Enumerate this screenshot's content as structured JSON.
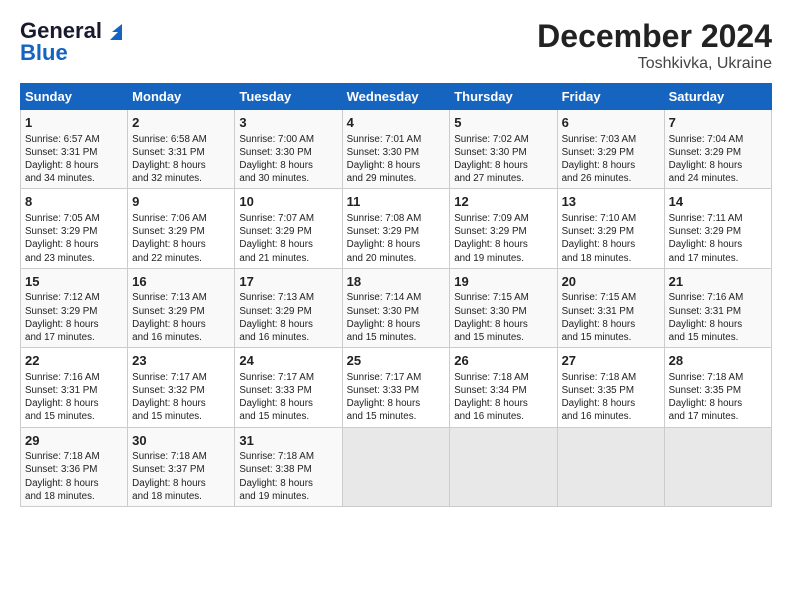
{
  "logo": {
    "line1": "General",
    "line2": "Blue"
  },
  "title": "December 2024",
  "subtitle": "Toshkivka, Ukraine",
  "headers": [
    "Sunday",
    "Monday",
    "Tuesday",
    "Wednesday",
    "Thursday",
    "Friday",
    "Saturday"
  ],
  "weeks": [
    [
      {
        "day": "1",
        "info": "Sunrise: 6:57 AM\nSunset: 3:31 PM\nDaylight: 8 hours\nand 34 minutes."
      },
      {
        "day": "2",
        "info": "Sunrise: 6:58 AM\nSunset: 3:31 PM\nDaylight: 8 hours\nand 32 minutes."
      },
      {
        "day": "3",
        "info": "Sunrise: 7:00 AM\nSunset: 3:30 PM\nDaylight: 8 hours\nand 30 minutes."
      },
      {
        "day": "4",
        "info": "Sunrise: 7:01 AM\nSunset: 3:30 PM\nDaylight: 8 hours\nand 29 minutes."
      },
      {
        "day": "5",
        "info": "Sunrise: 7:02 AM\nSunset: 3:30 PM\nDaylight: 8 hours\nand 27 minutes."
      },
      {
        "day": "6",
        "info": "Sunrise: 7:03 AM\nSunset: 3:29 PM\nDaylight: 8 hours\nand 26 minutes."
      },
      {
        "day": "7",
        "info": "Sunrise: 7:04 AM\nSunset: 3:29 PM\nDaylight: 8 hours\nand 24 minutes."
      }
    ],
    [
      {
        "day": "8",
        "info": "Sunrise: 7:05 AM\nSunset: 3:29 PM\nDaylight: 8 hours\nand 23 minutes."
      },
      {
        "day": "9",
        "info": "Sunrise: 7:06 AM\nSunset: 3:29 PM\nDaylight: 8 hours\nand 22 minutes."
      },
      {
        "day": "10",
        "info": "Sunrise: 7:07 AM\nSunset: 3:29 PM\nDaylight: 8 hours\nand 21 minutes."
      },
      {
        "day": "11",
        "info": "Sunrise: 7:08 AM\nSunset: 3:29 PM\nDaylight: 8 hours\nand 20 minutes."
      },
      {
        "day": "12",
        "info": "Sunrise: 7:09 AM\nSunset: 3:29 PM\nDaylight: 8 hours\nand 19 minutes."
      },
      {
        "day": "13",
        "info": "Sunrise: 7:10 AM\nSunset: 3:29 PM\nDaylight: 8 hours\nand 18 minutes."
      },
      {
        "day": "14",
        "info": "Sunrise: 7:11 AM\nSunset: 3:29 PM\nDaylight: 8 hours\nand 17 minutes."
      }
    ],
    [
      {
        "day": "15",
        "info": "Sunrise: 7:12 AM\nSunset: 3:29 PM\nDaylight: 8 hours\nand 17 minutes."
      },
      {
        "day": "16",
        "info": "Sunrise: 7:13 AM\nSunset: 3:29 PM\nDaylight: 8 hours\nand 16 minutes."
      },
      {
        "day": "17",
        "info": "Sunrise: 7:13 AM\nSunset: 3:29 PM\nDaylight: 8 hours\nand 16 minutes."
      },
      {
        "day": "18",
        "info": "Sunrise: 7:14 AM\nSunset: 3:30 PM\nDaylight: 8 hours\nand 15 minutes."
      },
      {
        "day": "19",
        "info": "Sunrise: 7:15 AM\nSunset: 3:30 PM\nDaylight: 8 hours\nand 15 minutes."
      },
      {
        "day": "20",
        "info": "Sunrise: 7:15 AM\nSunset: 3:31 PM\nDaylight: 8 hours\nand 15 minutes."
      },
      {
        "day": "21",
        "info": "Sunrise: 7:16 AM\nSunset: 3:31 PM\nDaylight: 8 hours\nand 15 minutes."
      }
    ],
    [
      {
        "day": "22",
        "info": "Sunrise: 7:16 AM\nSunset: 3:31 PM\nDaylight: 8 hours\nand 15 minutes."
      },
      {
        "day": "23",
        "info": "Sunrise: 7:17 AM\nSunset: 3:32 PM\nDaylight: 8 hours\nand 15 minutes."
      },
      {
        "day": "24",
        "info": "Sunrise: 7:17 AM\nSunset: 3:33 PM\nDaylight: 8 hours\nand 15 minutes."
      },
      {
        "day": "25",
        "info": "Sunrise: 7:17 AM\nSunset: 3:33 PM\nDaylight: 8 hours\nand 15 minutes."
      },
      {
        "day": "26",
        "info": "Sunrise: 7:18 AM\nSunset: 3:34 PM\nDaylight: 8 hours\nand 16 minutes."
      },
      {
        "day": "27",
        "info": "Sunrise: 7:18 AM\nSunset: 3:35 PM\nDaylight: 8 hours\nand 16 minutes."
      },
      {
        "day": "28",
        "info": "Sunrise: 7:18 AM\nSunset: 3:35 PM\nDaylight: 8 hours\nand 17 minutes."
      }
    ],
    [
      {
        "day": "29",
        "info": "Sunrise: 7:18 AM\nSunset: 3:36 PM\nDaylight: 8 hours\nand 18 minutes."
      },
      {
        "day": "30",
        "info": "Sunrise: 7:18 AM\nSunset: 3:37 PM\nDaylight: 8 hours\nand 18 minutes."
      },
      {
        "day": "31",
        "info": "Sunrise: 7:18 AM\nSunset: 3:38 PM\nDaylight: 8 hours\nand 19 minutes."
      },
      null,
      null,
      null,
      null
    ]
  ]
}
